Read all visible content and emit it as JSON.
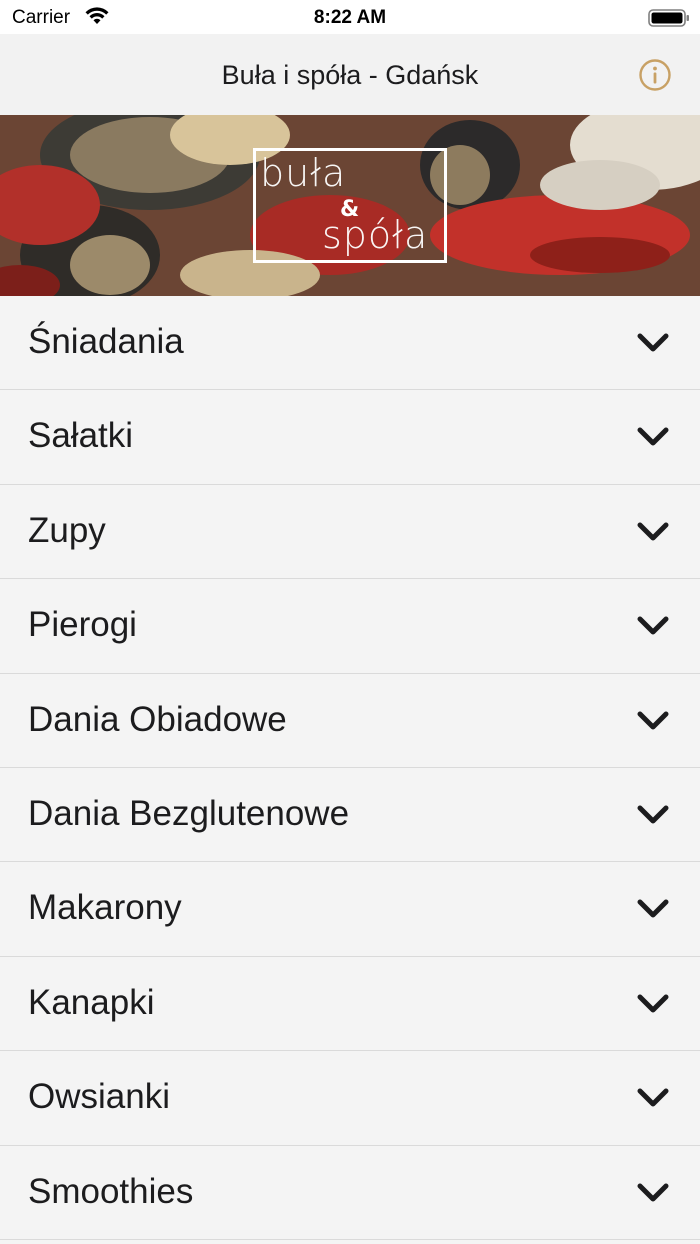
{
  "status_bar": {
    "carrier": "Carrier",
    "time": "8:22 AM"
  },
  "nav": {
    "title": "Buła i spóła - Gdańsk",
    "info_icon": "info-icon",
    "accent_color": "#c8a165"
  },
  "hero": {
    "logo_top": "buła",
    "logo_amp": "&",
    "logo_bottom": "spóła"
  },
  "menu": {
    "chevron_icon": "chevron-down-icon",
    "items": [
      {
        "label": "Śniadania"
      },
      {
        "label": "Sałatki"
      },
      {
        "label": "Zupy"
      },
      {
        "label": "Pierogi"
      },
      {
        "label": "Dania Obiadowe"
      },
      {
        "label": "Dania Bezglutenowe"
      },
      {
        "label": "Makarony"
      },
      {
        "label": "Kanapki"
      },
      {
        "label": "Owsianki"
      },
      {
        "label": "Smoothies"
      }
    ]
  }
}
